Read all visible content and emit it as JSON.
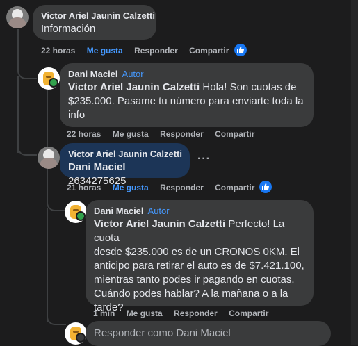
{
  "comment1": {
    "author": "Victor Ariel Jaunin Calzetti",
    "text": "Información",
    "actions": {
      "time": "22 horas",
      "like": "Me gusta",
      "reply": "Responder",
      "share": "Compartir"
    }
  },
  "reply1": {
    "author": "Dani Maciel",
    "badge": "Autor",
    "mention": "Victor Ariel Jaunin Calzetti",
    "text_line1": "Hola! Son cuotas de",
    "text_line2": "$235.000. Pasame tu número para enviarte toda la",
    "text_line3": "info",
    "actions": {
      "time": "22 horas",
      "like": "Me gusta",
      "reply": "Responder",
      "share": "Compartir"
    }
  },
  "reply2": {
    "author": "Victor Ariel Jaunin Calzetti",
    "mention": "Dani Maciel",
    "text": "2634275625",
    "more": "···",
    "actions": {
      "time": "21 horas",
      "like": "Me gusta",
      "reply": "Responder",
      "share": "Compartir"
    }
  },
  "reply3": {
    "author": "Dani Maciel",
    "badge": "Autor",
    "mention": "Victor Ariel Jaunin Calzetti",
    "text_line1": "Perfecto! La cuota",
    "text_line2": "desde $235.000 es de un CRONOS 0KM. El",
    "text_line3": "anticipo para retirar el auto es de $7.421.100,",
    "text_line4": "mientras tanto podes ir pagando en cuotas.",
    "text_line5": "Cuándo podes hablar? A la mañana o a la",
    "text_line6": "tarde?",
    "actions": {
      "time": "1 min",
      "like": "Me gusta",
      "reply": "Responder",
      "share": "Compartir"
    }
  },
  "reply_box": {
    "placeholder": "Responder como Dani Maciel"
  },
  "colors": {
    "background": "#1c1c1d",
    "bubble": "#3a3b3c",
    "highlight_bubble": "#1c3557",
    "link_blue": "#4599ff",
    "like_blue": "#1877f2"
  },
  "icons": {
    "like": "thumbs-up-icon",
    "online": "online-status-dot"
  }
}
